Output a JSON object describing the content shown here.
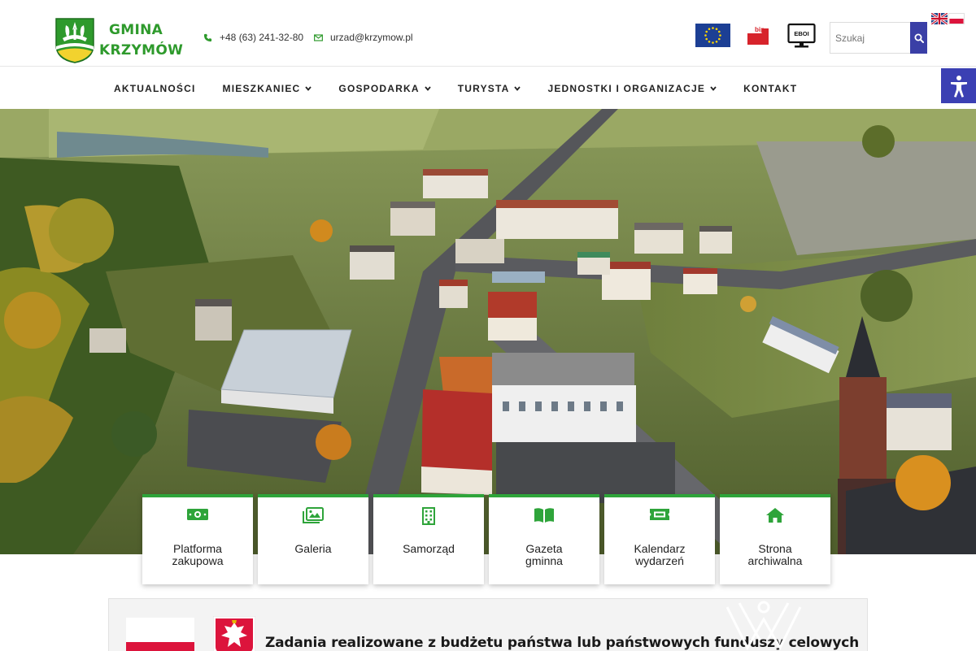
{
  "header": {
    "logo_line1": "GMINA",
    "logo_line2": "KRZYMÓW",
    "phone": "+48 (63) 241-32-80",
    "email": "urzad@krzymow.pl",
    "search_placeholder": "Szukaj"
  },
  "badges": {
    "bip_label": "bip",
    "eboi_label": "EBOI"
  },
  "nav": {
    "items": [
      {
        "label": "AKTUALNOŚCI",
        "dropdown": false
      },
      {
        "label": "MIESZKANIEC",
        "dropdown": true
      },
      {
        "label": "GOSPODARKA",
        "dropdown": true
      },
      {
        "label": "TURYSTA",
        "dropdown": true
      },
      {
        "label": "JEDNOSTKI I ORGANIZACJE",
        "dropdown": true
      },
      {
        "label": "KONTAKT",
        "dropdown": false
      }
    ]
  },
  "tiles": [
    {
      "line1": "Platforma",
      "line2": "zakupowa",
      "icon": "money-icon"
    },
    {
      "line1": "Galeria",
      "line2": "",
      "icon": "images-icon"
    },
    {
      "line1": "Samorząd",
      "line2": "",
      "icon": "building-icon"
    },
    {
      "line1": "Gazeta",
      "line2": "gminna",
      "icon": "book-icon"
    },
    {
      "line1": "Kalendarz",
      "line2": "wydarzeń",
      "icon": "ticket-icon"
    },
    {
      "line1": "Strona",
      "line2": "archiwalna",
      "icon": "home-icon"
    }
  ],
  "banner": {
    "text": "Zadania realizowane z budżetu państwa lub państwowych funduszy celowych"
  },
  "colors": {
    "brand_green": "#2e9a2c",
    "tile_accent": "#2ea43a",
    "search_blue": "#3a3fa6",
    "a11y_blue": "#3b40b3",
    "eu_blue": "#1c3f94"
  }
}
